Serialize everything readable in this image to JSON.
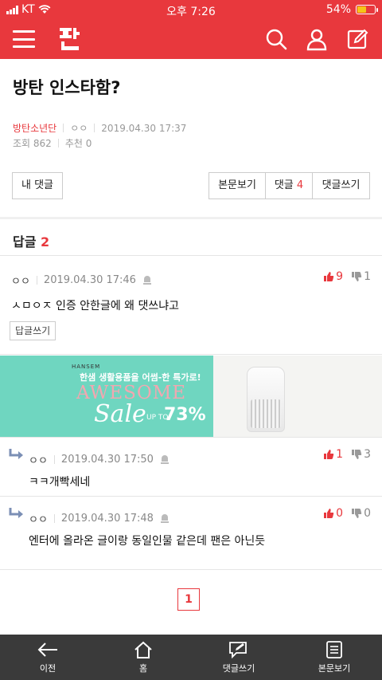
{
  "status_bar": {
    "carrier": "KT",
    "time": "오후 7:26",
    "battery": "54%"
  },
  "post": {
    "title": "방탄 인스타함?",
    "board": "방탄소년단",
    "author": "ㅇㅇ",
    "date": "2019.04.30 17:37",
    "views": "조회 862",
    "recommends": "추천 0"
  },
  "actions": {
    "my_comments": "내 댓글",
    "view_post": "본문보기",
    "comments_label": "댓글",
    "comments_count": "4",
    "write_comment": "댓글쓰기"
  },
  "replies": {
    "label": "답글",
    "count": "2"
  },
  "comments": [
    {
      "author": "ㅇㅇ",
      "date": "2019.04.30 17:46",
      "up": "9",
      "down": "1",
      "body": "ㅅㅁㅇㅈ 인증 안한글에 왜 댓쓰냐고",
      "reply_button": "답글쓰기"
    },
    {
      "author": "ㅇㅇ",
      "date": "2019.04.30 17:50",
      "up": "1",
      "down": "3",
      "body": "ㅋㅋ개빡세네"
    },
    {
      "author": "ㅇㅇ",
      "date": "2019.04.30 17:48",
      "up": "0",
      "down": "0",
      "body": "엔터에 올라온 글이랑 동일인물 같은데 팬은 아닌듯"
    }
  ],
  "ad": {
    "brand": "HANSEM",
    "line1": "한샘 생활용품을 어썸-한 특가로!",
    "headline": "AWESOME",
    "sale": "Sale",
    "up_to": "UP TO",
    "percent": "73%"
  },
  "pagination": {
    "current": "1"
  },
  "bottom_nav": {
    "prev": "이전",
    "home": "홈",
    "write_comment": "댓글쓰기",
    "view_post": "본문보기"
  },
  "colors": {
    "brand_red": "#e8383d",
    "bottom_bar": "#3a3a3a",
    "ad_bg": "#6fd6c0"
  }
}
